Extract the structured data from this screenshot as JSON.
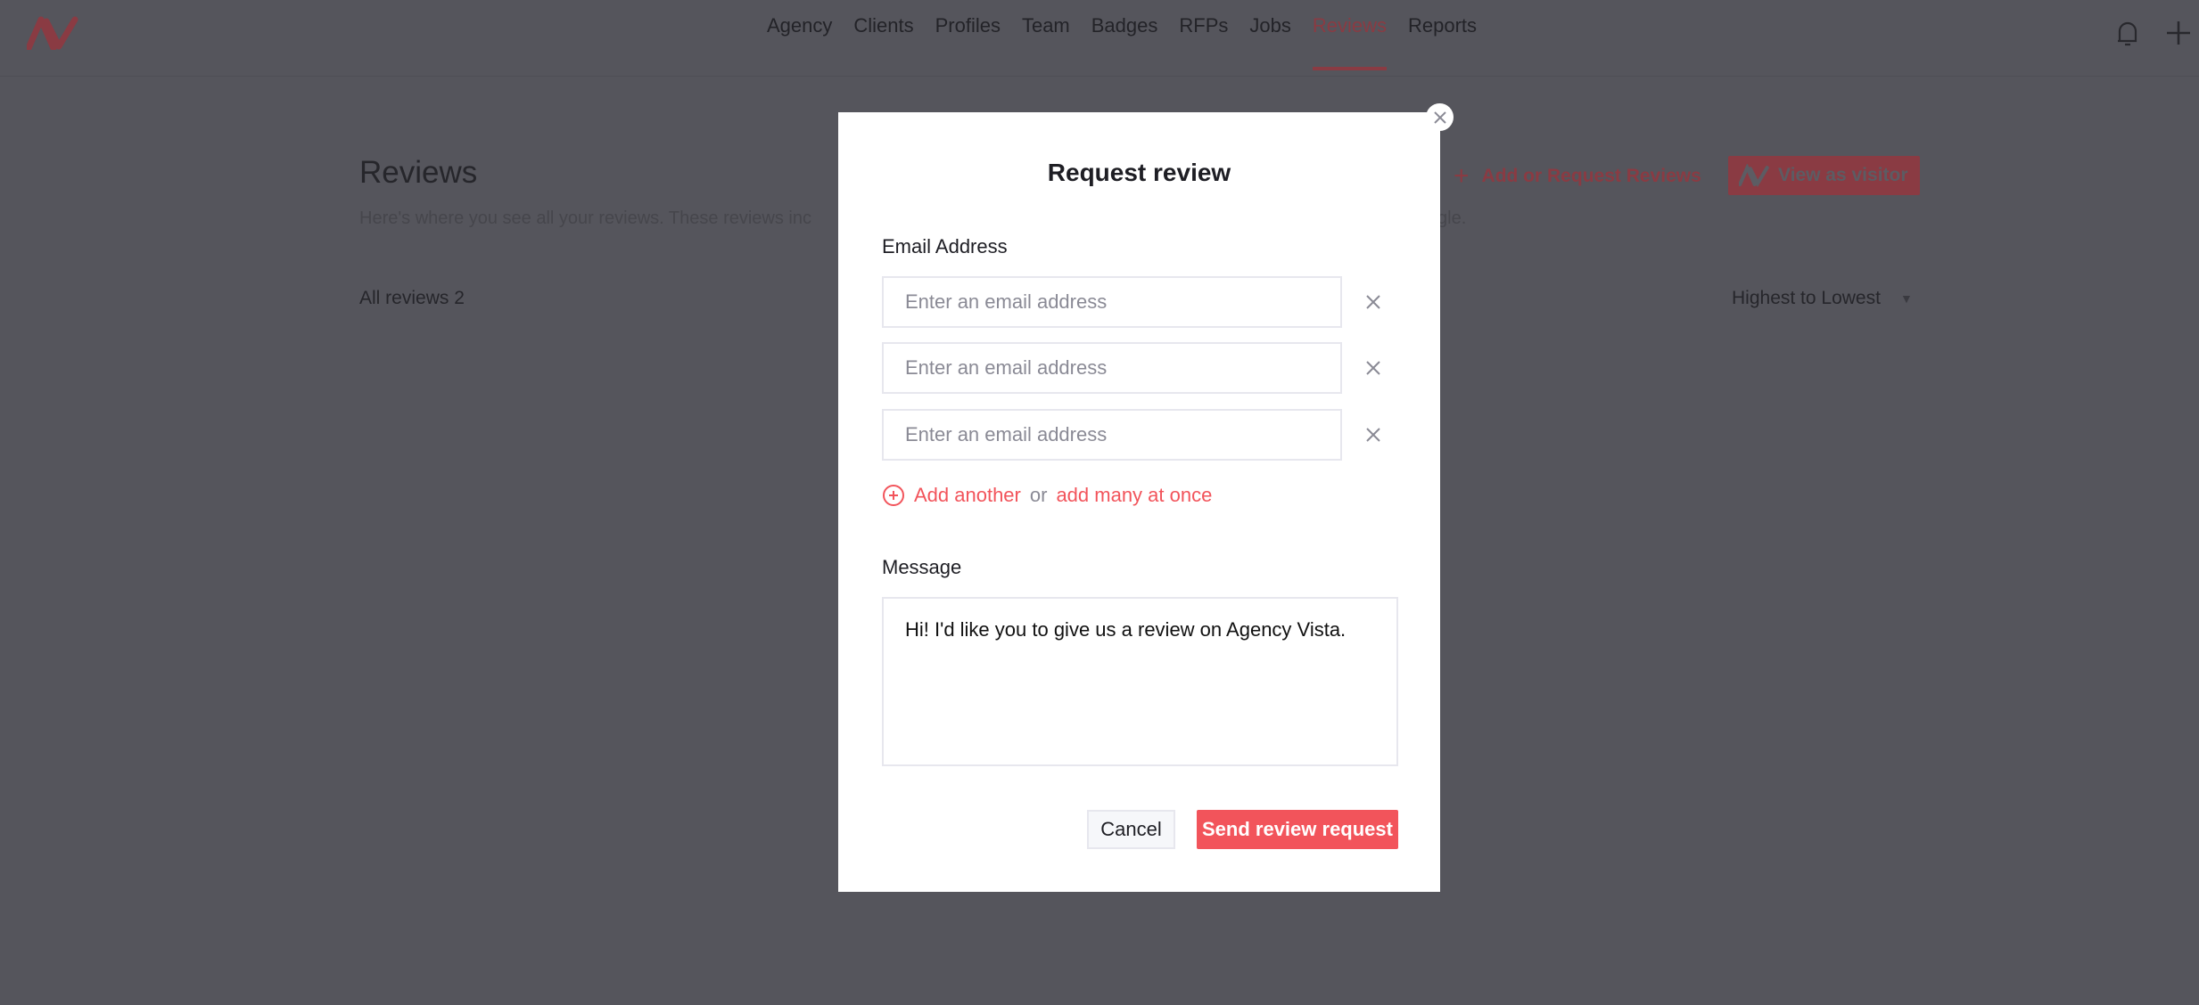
{
  "nav": {
    "items": [
      {
        "label": "Agency"
      },
      {
        "label": "Clients"
      },
      {
        "label": "Profiles"
      },
      {
        "label": "Team"
      },
      {
        "label": "Badges"
      },
      {
        "label": "RFPs"
      },
      {
        "label": "Jobs"
      },
      {
        "label": "Reviews",
        "active": true
      },
      {
        "label": "Reports"
      }
    ],
    "icons": {
      "logo": "agency-vista-logo",
      "bell": "bell-icon",
      "plus": "plus-icon"
    }
  },
  "page": {
    "title": "Reviews",
    "subtitle_start": "Here's where you see all your reviews. These reviews inc",
    "subtitle_end": "gle.",
    "all_reviews": "All reviews 2",
    "add_request": "Add or Request Reviews",
    "view_as_visitor": "View as visitor",
    "sort": "Highest to Lowest"
  },
  "modal": {
    "title": "Request review",
    "email_label": "Email Address",
    "email_placeholder": "Enter an email address",
    "emails": [
      "",
      "",
      ""
    ],
    "add_another": "Add another",
    "or": "or",
    "add_many": "add many at once",
    "message_label": "Message",
    "message": "Hi! I'd like you to give us a review on Agency Vista.",
    "cancel": "Cancel",
    "send": "Send review request"
  },
  "colors": {
    "accent": "#f2545b",
    "overlay": "#55555c"
  }
}
